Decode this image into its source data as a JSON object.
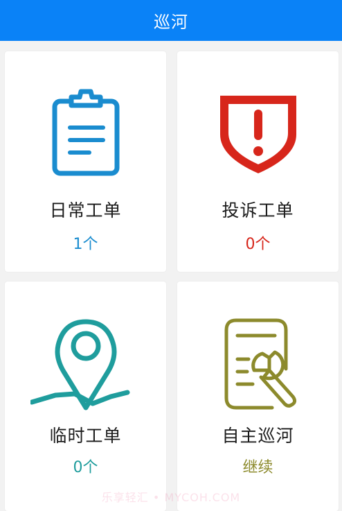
{
  "header": {
    "title": "巡河"
  },
  "colors": {
    "header_bg": "#0a82f7",
    "daily": "#1a8ccf",
    "complaint": "#d7261b",
    "temporary": "#1f9d9d",
    "self_patrol": "#8c8a2c"
  },
  "cards": [
    {
      "title": "日常工单",
      "count": "1个",
      "icon": "clipboard-icon"
    },
    {
      "title": "投诉工单",
      "count": "0个",
      "icon": "alert-shield-icon"
    },
    {
      "title": "临时工单",
      "count": "0个",
      "icon": "map-pin-icon"
    },
    {
      "title": "自主巡河",
      "count": "继续",
      "icon": "document-wrench-icon"
    }
  ],
  "watermark": "乐享轻汇 • MYCOH.COM"
}
